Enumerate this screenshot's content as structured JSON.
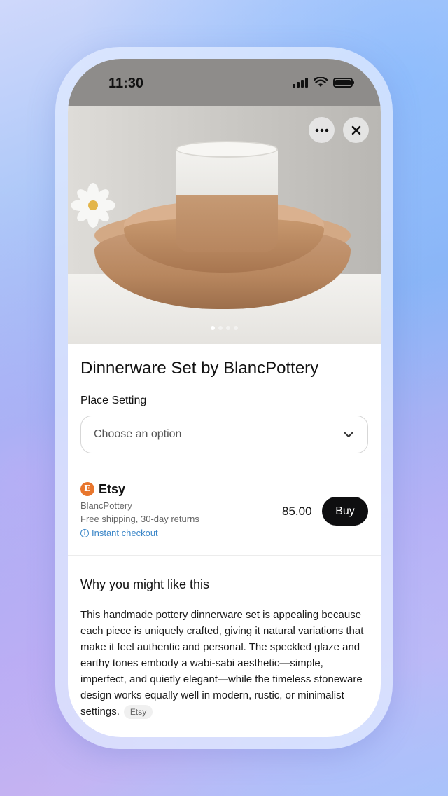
{
  "status_bar": {
    "time": "11:30"
  },
  "product": {
    "title": "Dinnerware Set by BlancPottery",
    "option_label": "Place Setting",
    "option_placeholder": "Choose an option",
    "image_count": 4,
    "image_active_index": 0
  },
  "merchant": {
    "logo_letter": "E",
    "name": "Etsy",
    "seller": "BlancPottery",
    "shipping": "Free shipping, 30-day returns",
    "checkout": "Instant checkout",
    "price": "85.00",
    "buy_label": "Buy"
  },
  "why": {
    "title": "Why you might like this",
    "body": "This handmade pottery dinnerware set is appealing because each piece is uniquely crafted, giving it natural variations that make it feel authentic and personal. The speckled glaze and earthy tones embody a wabi-sabi aesthetic—simple, imperfect, and quietly elegant—while the timeless stoneware design works equally well in modern, rustic, or minimalist settings.",
    "source": "Etsy"
  },
  "icons": {
    "more": "more-icon",
    "close": "close-icon",
    "chevron": "chevron-down-icon",
    "info": "info-icon"
  },
  "colors": {
    "accent_link": "#3a86c8",
    "buy_button": "#0e0e10",
    "etsy_orange": "#e8762d"
  }
}
